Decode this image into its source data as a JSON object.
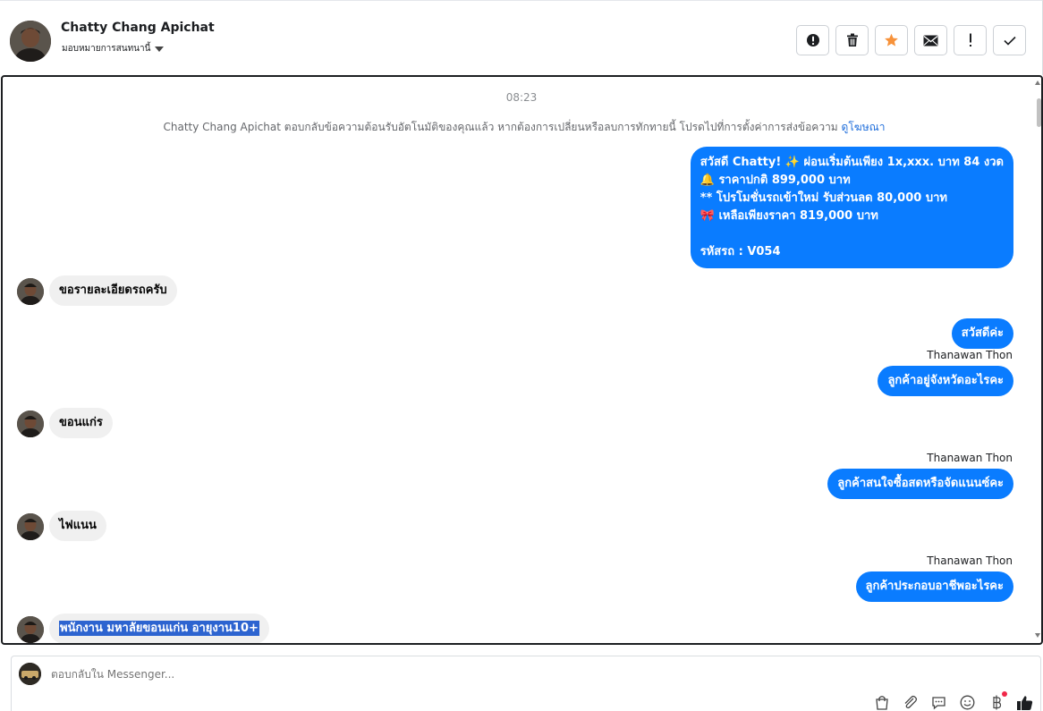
{
  "header": {
    "contact_name": "Chatty Chang Apichat",
    "assign_label": "มอบหมายการสนทนานี้",
    "buttons": [
      {
        "name": "report-spam-button",
        "icon": "alert-circle-icon"
      },
      {
        "name": "delete-button",
        "icon": "trash-icon"
      },
      {
        "name": "star-button",
        "icon": "star-icon"
      },
      {
        "name": "mark-unread-button",
        "icon": "envelope-icon"
      },
      {
        "name": "follow-up-button",
        "icon": "exclamation-icon"
      },
      {
        "name": "mark-done-button",
        "icon": "check-icon"
      }
    ]
  },
  "colors": {
    "outgoing_bubble": "#0a7cff",
    "incoming_bubble": "#f0f0f0",
    "star": "#f7923a",
    "link": "#216fdb",
    "selection": "#2d64d0"
  },
  "chat": {
    "timestamp": "08:23",
    "notice_text": "Chatty Chang Apichat ตอบกลับข้อความต้อนรับอัตโนมัติของคุณแล้ว หากต้องการเปลี่ยนหรือลบการทักทายนี้ โปรดไปที่การตั้งค่าการส่งข้อความ",
    "notice_link": "ดูโฆษณา",
    "promo_lines": [
      "สวัสดี Chatty! ✨  ผ่อนเริ่มต้นเพียง 1x,xxx. บาท 84 งวด",
      "🔔  ราคาปกติ 899,000 บาท",
      "** โปรโมชั่นรถเข้าใหม่ รับส่วนลด 80,000 บาท",
      "🎀  เหลือเพียงราคา 819,000 บาท",
      "",
      " รหัสรถ : V054"
    ],
    "incoming_1": "ขอรายละเอียดรถครับ",
    "outgoing_1": "สวัสดีค่ะ",
    "sender_1": "Thanawan Thon",
    "outgoing_2": "ลูกค้าอยู่จังหวัดอะไรคะ",
    "incoming_2": "ขอนแก่ร",
    "sender_2": "Thanawan Thon",
    "outgoing_3": "ลูกค้าสนใจซื้อสดหรือจัดแนนซ์คะ",
    "incoming_3": "ไฟแนน",
    "sender_3": "Thanawan Thon",
    "outgoing_4": "ลูกค้าประกอบอาชีพอะไรคะ",
    "incoming_4": "พนักงาน มหาลัยขอนแก่น อายุงาน10+"
  },
  "composer": {
    "placeholder": "ตอบกลับใน Messenger...",
    "icons": [
      "shopping-bag-icon",
      "paperclip-icon",
      "saved-reply-icon",
      "emoji-icon",
      "baht-payment-icon",
      "thumbs-up-icon"
    ]
  }
}
